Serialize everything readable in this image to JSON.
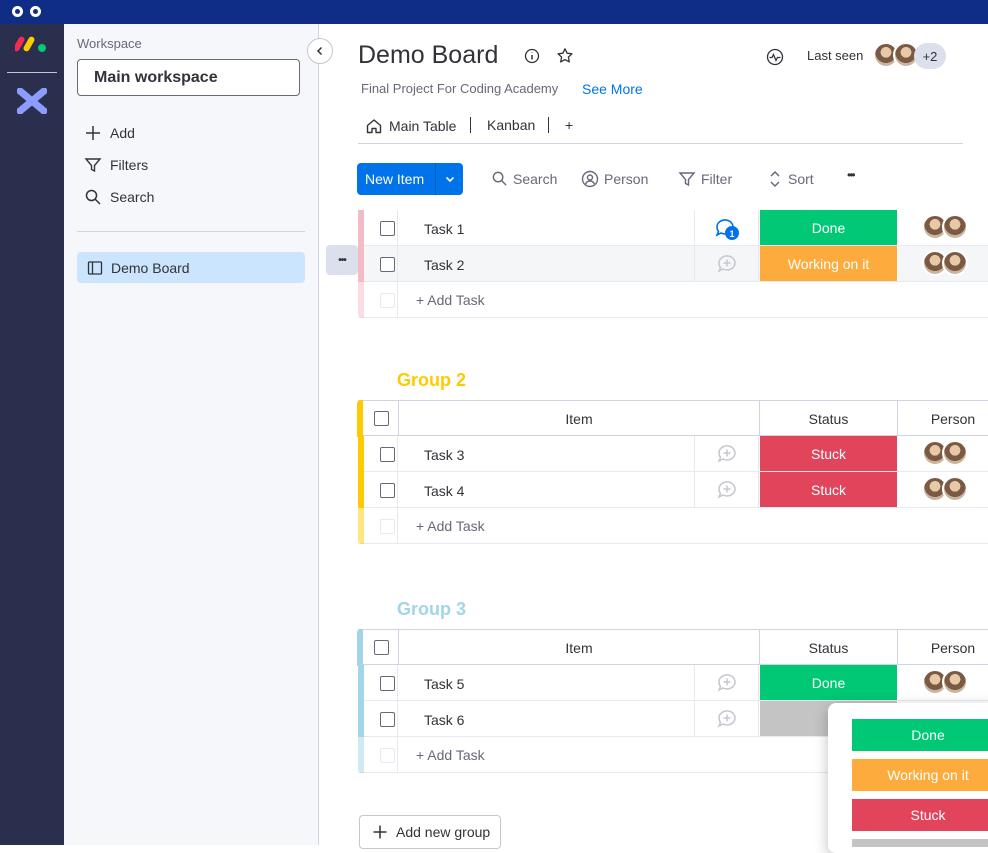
{
  "colors": {
    "done": "#00c875",
    "working": "#fdab3d",
    "stuck": "#e2445c",
    "empty": "#c4c4c4",
    "group1": "#f3bcc5",
    "group2": "#ffcb00",
    "group3": "#a1d5e7",
    "primary": "#0073ea"
  },
  "sidebar": {
    "workspace_label": "Workspace",
    "workspace_name": "Main workspace",
    "add_label": "Add",
    "filters_label": "Filters",
    "search_label": "Search",
    "board_name": "Demo Board"
  },
  "header": {
    "title": "Demo Board",
    "description": "Final Project For Coding Academy",
    "see_more": "See More",
    "last_seen": "Last seen",
    "extra_count": "+2"
  },
  "tabs": {
    "main_table": "Main Table",
    "kanban": "Kanban",
    "add": "+"
  },
  "toolbar": {
    "new_item": "New Item",
    "search": "Search",
    "person": "Person",
    "filter": "Filter",
    "sort": "Sort",
    "more": "•••"
  },
  "table_headers": {
    "item": "Item",
    "status": "Status",
    "person": "Person"
  },
  "groups": [
    {
      "name": "",
      "tasks": [
        {
          "name": "Task 1",
          "status": "Done",
          "comments": "1"
        },
        {
          "name": "Task 2",
          "status": "Working on it",
          "comments": ""
        }
      ],
      "add_task": "+ Add Task"
    },
    {
      "name": "Group 2",
      "tasks": [
        {
          "name": "Task 3",
          "status": "Stuck",
          "comments": ""
        },
        {
          "name": "Task 4",
          "status": "Stuck",
          "comments": ""
        }
      ],
      "add_task": "+ Add Task"
    },
    {
      "name": "Group 3",
      "tasks": [
        {
          "name": "Task 5",
          "status": "Done",
          "comments": ""
        },
        {
          "name": "Task 6",
          "status": "",
          "comments": ""
        }
      ],
      "add_task": "+ Add Task"
    }
  ],
  "add_group": "Add new group",
  "status_dropdown": {
    "options": [
      "Done",
      "Working on it",
      "Stuck"
    ]
  },
  "row_menu": "•••"
}
